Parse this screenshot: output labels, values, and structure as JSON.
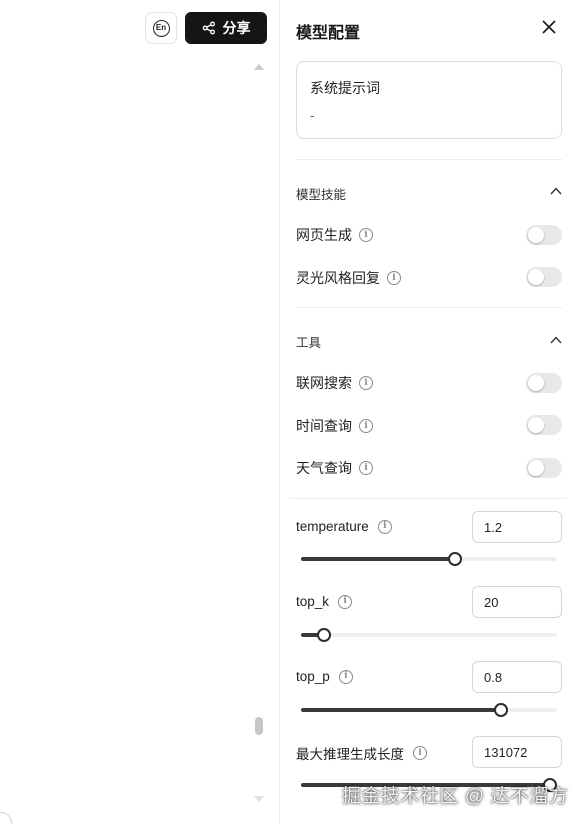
{
  "toolbar": {
    "lang_label": "En",
    "share_label": "分享"
  },
  "panel": {
    "title": "模型配置",
    "system_prompt": {
      "label": "系统提示词",
      "value": "-"
    },
    "skills": {
      "title": "模型技能",
      "items": [
        {
          "label": "网页生成",
          "enabled": false
        },
        {
          "label": "灵光风格回复",
          "enabled": false
        }
      ]
    },
    "tools": {
      "title": "工具",
      "items": [
        {
          "label": "联网搜索",
          "enabled": false
        },
        {
          "label": "时间查询",
          "enabled": false
        },
        {
          "label": "天气查询",
          "enabled": false
        }
      ]
    },
    "params": [
      {
        "label": "temperature",
        "value": "1.2",
        "fraction": 0.6
      },
      {
        "label": "top_k",
        "value": "20",
        "fraction": 0.09
      },
      {
        "label": "top_p",
        "value": "0.8",
        "fraction": 0.78
      },
      {
        "label": "最大推理生成长度",
        "value": "131072",
        "fraction": 1.0
      }
    ]
  },
  "watermark": "掘金技术社区 @ 达不溜方",
  "colors": {
    "share_bg": "#151515",
    "toggle_off": "#e8e8e8",
    "slider_fill": "#3a3a3a"
  }
}
